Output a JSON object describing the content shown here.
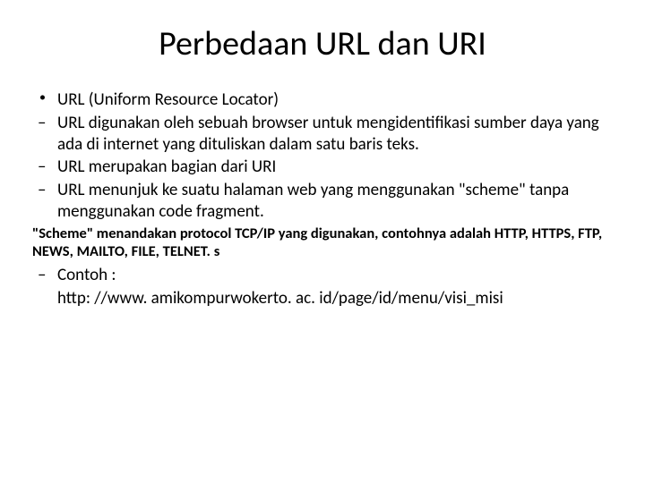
{
  "title": "Perbedaan URL  dan URI",
  "item1": "URL (Uniform Resource Locator)",
  "sub1": "URL digunakan oleh sebuah browser untuk mengidentifikasi sumber daya yang ada di internet yang dituliskan dalam satu baris teks.",
  "sub2": "URL merupakan bagian dari URI",
  "sub3": "URL menunjuk ke suatu halaman web yang menggunakan \"scheme\" tanpa menggunakan code fragment.",
  "note": "\"Scheme\" menandakan protocol TCP/IP yang digunakan, contohnya adalah HTTP, HTTPS, FTP, NEWS, MAILTO, FILE, TELNET. s",
  "sub4": "Contoh :",
  "example": "http: //www. amikompurwokerto. ac. id/page/id/menu/visi_misi"
}
